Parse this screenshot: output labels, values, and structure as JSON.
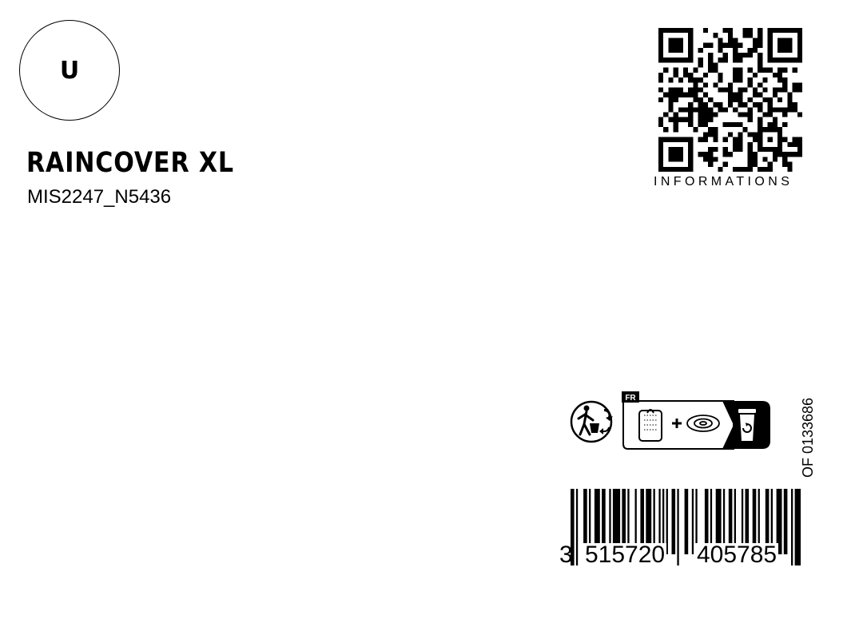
{
  "size_badge": "U",
  "product": {
    "name": "RAINCOVER XL",
    "code": "MIS2247_N5436"
  },
  "qr": {
    "caption": "INFORMATIONS"
  },
  "recycling": {
    "country_tag": "FR"
  },
  "lot_code": "OF 0133686",
  "barcode": {
    "first_digit": "3",
    "left_group": "515720",
    "right_group": "405785"
  }
}
